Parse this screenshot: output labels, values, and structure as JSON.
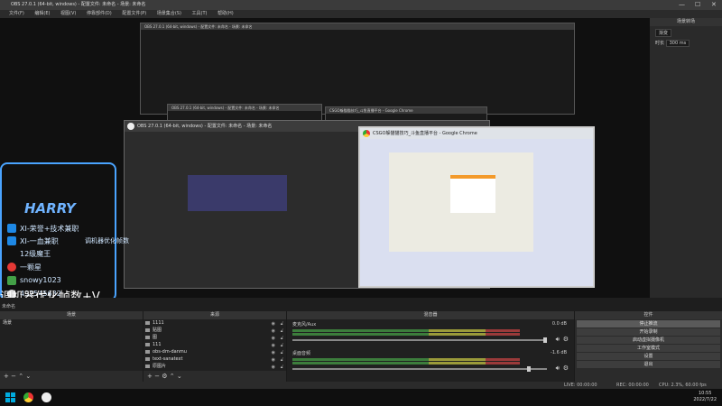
{
  "window": {
    "title": "OBS 27.0.1 (64-bit, windows) - 配置文件: 未命名 - 场景: 未命名",
    "min": "—",
    "max": "☐",
    "close": "✕"
  },
  "menu": [
    "文件(F)",
    "编辑(E)",
    "视图(V)",
    "停靠部件(D)",
    "配置文件(P)",
    "场景集合(S)",
    "工具(T)",
    "帮助(H)"
  ],
  "right_panel": {
    "title": "场景转场",
    "transition": "渐变",
    "duration_label": "时长",
    "duration": "300 ms"
  },
  "preview": {
    "obs_window_title": "OBS 27.0.1 (64-bit, windows) - 配置文件: 未命名 - 场景: 未命名",
    "chrome_window_title": "CSGO躲猫猫技巧_斗鱼直播平台 - Google Chrome",
    "small_obs_title": "OBS 27.0.1 (64-bit, windows) - 配置文件: 未命名 - 场景: 未命名",
    "small_chrome_title": "CSGO躲猫猫技巧_斗鱼直播平台 - Google Chrome"
  },
  "overlay": {
    "logo": "HARRY",
    "lines": [
      "XI-荣誉+技术兼职",
      "XI-一血兼职",
      "12级魔王",
      "一颗星",
      "snowy1023",
      "492545632"
    ],
    "side": "调机器优化帧数"
  },
  "big_text": "调机器优化帧数+V",
  "scene_label": "未命名",
  "docks": {
    "scenes": {
      "title": "场景",
      "items": [
        "场景"
      ]
    },
    "sources": {
      "title": "来源",
      "items": [
        "1111",
        "贴图",
        "图",
        "111",
        "obs-dm-danmu",
        "text-sanatext",
        "原图片"
      ]
    },
    "mixer": {
      "title": "混音器",
      "channels": [
        {
          "name": "麦克风/Aux",
          "db": "0.0 dB"
        },
        {
          "name": "桌面音频",
          "db": "-1.6 dB"
        }
      ]
    },
    "controls": {
      "title": "控件",
      "buttons": [
        "停止推流",
        "开始录制",
        "启动虚拟摄像机",
        "工作室模式",
        "设置",
        "退出"
      ]
    }
  },
  "status": {
    "live": "LIVE: 00:00:00",
    "rec": "REC: 00:00:00",
    "cpu": "CPU: 2.3%, 60.00 fps"
  },
  "taskbar": {
    "time": "10:55",
    "date": "2022/7/22"
  },
  "colors": {
    "accent": "#4aa4ff",
    "meter_green": "#3c7d3c"
  }
}
